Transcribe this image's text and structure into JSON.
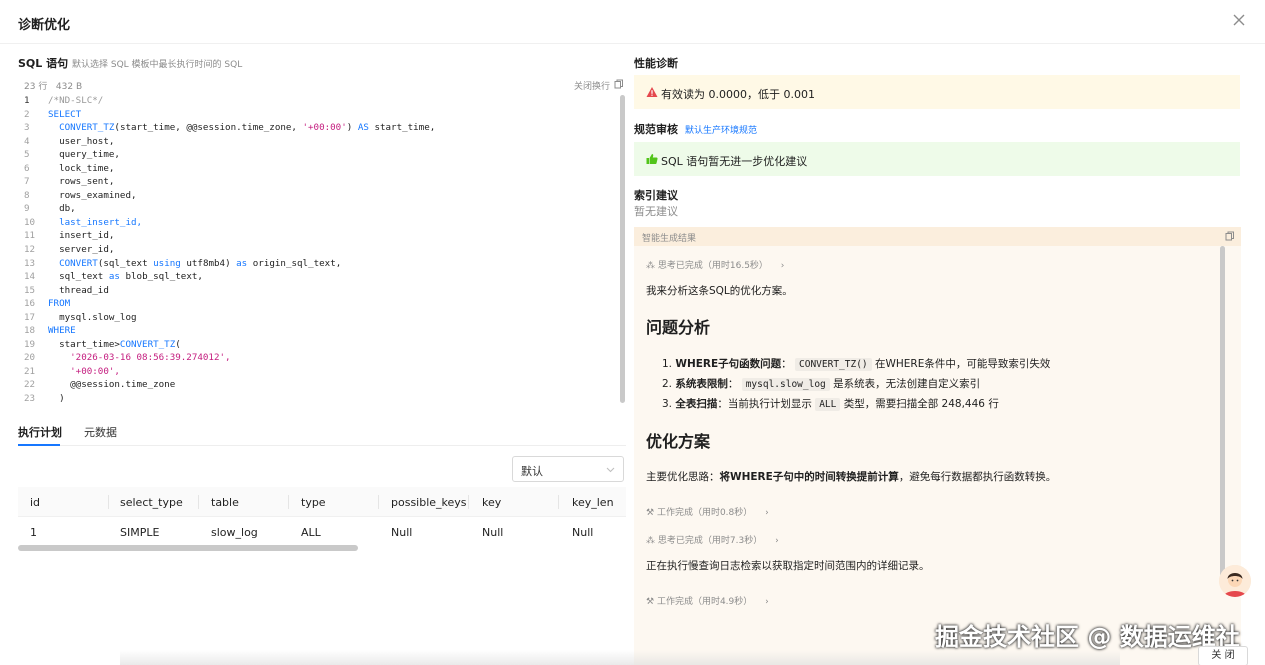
{
  "dialog": {
    "title": "诊断优化"
  },
  "sql": {
    "title": "SQL 语句",
    "hint": "默认选择 SQL 模板中最长执行时间的 SQL",
    "line_count": "23 行",
    "size": "432 B",
    "wrap_toggle": "关闭换行",
    "lines": [
      "/*ND-SLC*/",
      "SELECT",
      "  CONVERT_TZ(start_time, @@session.time_zone, '+00:00') AS start_time,",
      "  user_host,",
      "  query_time,",
      "  lock_time,",
      "  rows_sent,",
      "  rows_examined,",
      "  db,",
      "  last_insert_id,",
      "  insert_id,",
      "  server_id,",
      "  CONVERT(sql_text using utf8mb4) as origin_sql_text,",
      "  sql_text as blob_sql_text,",
      "  thread_id",
      "FROM",
      "  mysql.slow_log",
      "WHERE",
      "  start_time>CONVERT_TZ(",
      "    '2026-03-16 08:56:39.274012',",
      "    '+00:00',",
      "    @@session.time_zone",
      "  )"
    ]
  },
  "tabs": {
    "plan": "执行计划",
    "meta": "元数据"
  },
  "plan": {
    "select_value": "默认",
    "columns": [
      "id",
      "select_type",
      "table",
      "type",
      "possible_keys",
      "key",
      "key_len"
    ],
    "rows": [
      [
        "1",
        "SIMPLE",
        "slow_log",
        "ALL",
        "Null",
        "Null",
        "Null"
      ]
    ]
  },
  "perf": {
    "title": "性能诊断",
    "warning": "有效读为 0.0000，低于 0.001"
  },
  "review": {
    "title": "规范审核",
    "link": "默认生产环境规范",
    "ok": "SQL 语句暂无进一步优化建议"
  },
  "index": {
    "title": "索引建议",
    "empty": "暂无建议"
  },
  "ai": {
    "header": "智能生成结果",
    "step1": "思考已完成（用时16.5秒）",
    "intro": "我来分析这条SQL的优化方案。",
    "h_problem": "问题分析",
    "p1_b": "WHERE子句函数问题",
    "p1_sep": "：",
    "p1_code": "CONVERT_TZ()",
    "p1_rest": "在WHERE条件中，可能导致索引失效",
    "p2_b": "系统表限制",
    "p2_sep": "：",
    "p2_code": "mysql.slow_log",
    "p2_rest": "是系统表，无法创建自定义索引",
    "p3_b": "全表扫描",
    "p3_pre": "：当前执行计划显示",
    "p3_code": "ALL",
    "p3_rest": "类型，需要扫描全部 248,446 行",
    "h_plan": "优化方案",
    "plan_pre": "主要优化思路：",
    "plan_b": "将WHERE子句中的时间转换提前计算",
    "plan_rest": "，避免每行数据都执行函数转换。",
    "step2": "工作完成（用时0.8秒）",
    "step3": "思考已完成（用时7.3秒）",
    "exec": "正在执行慢查询日志检索以获取指定时间范围内的详细记录。",
    "step4": "工作完成（用时4.9秒）"
  },
  "watermark": "掘金技术社区 @ 数据运维社",
  "footer": {
    "close": "关 闭"
  },
  "colors": {
    "accent": "#1677ff",
    "warn_bg": "#fff9e6",
    "ok_bg": "#eefbe9",
    "ai_bg": "#fdf8f1"
  }
}
